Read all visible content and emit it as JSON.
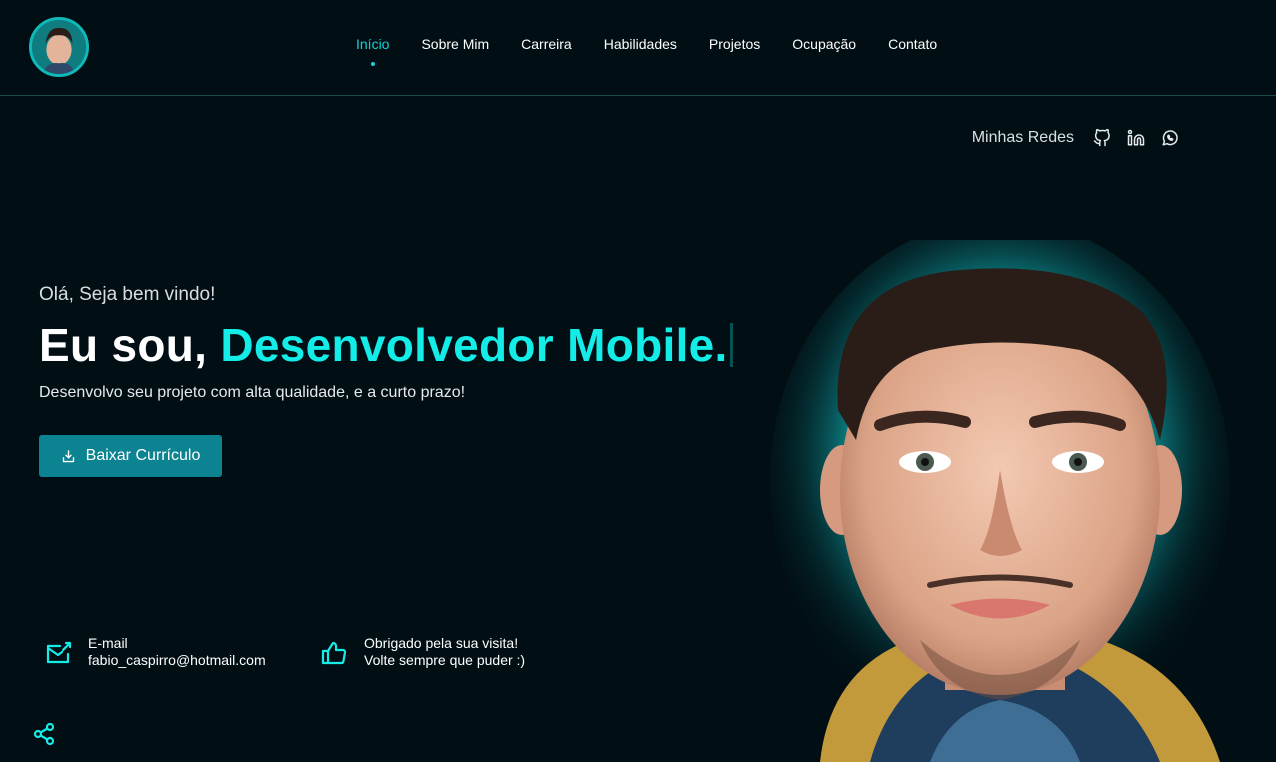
{
  "nav": {
    "items": [
      {
        "label": "Início",
        "active": true
      },
      {
        "label": "Sobre Mim",
        "active": false
      },
      {
        "label": "Carreira",
        "active": false
      },
      {
        "label": "Habilidades",
        "active": false
      },
      {
        "label": "Projetos",
        "active": false
      },
      {
        "label": "Ocupação",
        "active": false
      },
      {
        "label": "Contato",
        "active": false
      }
    ]
  },
  "socials": {
    "label": "Minhas Redes",
    "icons": [
      "github-icon",
      "linkedin-icon",
      "whatsapp-icon"
    ]
  },
  "hero": {
    "greeting": "Olá, Seja bem vindo!",
    "title_prefix": "Eu sou, ",
    "title_accent": "Desenvolvedor Mobile.",
    "subtitle": "Desenvolvo seu projeto com alta qualidade, e a curto prazo!",
    "cv_button": "Baixar Currículo"
  },
  "info": {
    "email_label": "E-mail",
    "email_value": "fabio_caspirro@hotmail.com",
    "thanks_line1": "Obrigado pela sua visita!",
    "thanks_line2": "Volte sempre que puder :)"
  },
  "colors": {
    "background": "#010f14",
    "accent": "#14ece8",
    "button": "#0b8390"
  }
}
